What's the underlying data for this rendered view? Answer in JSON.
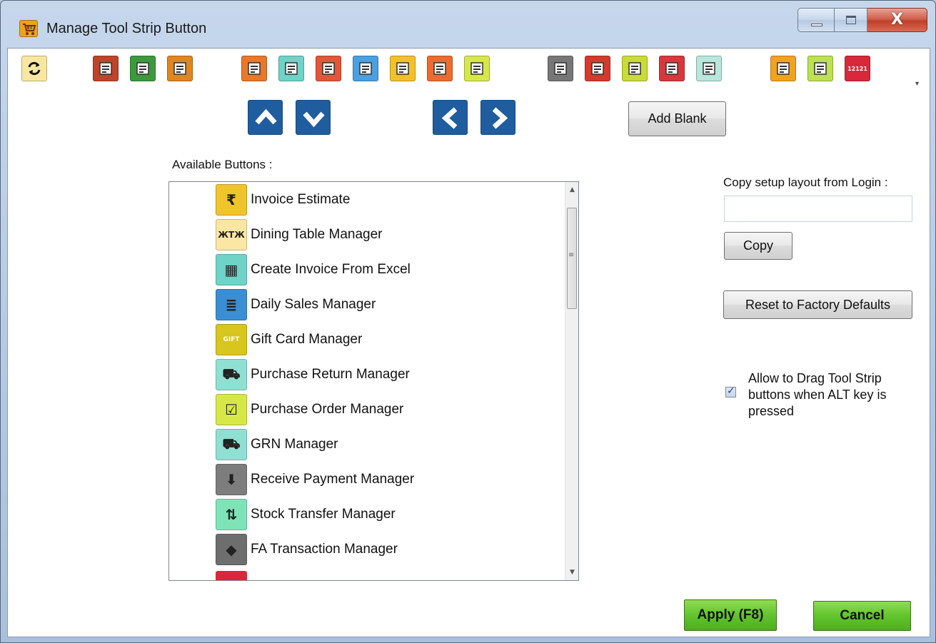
{
  "window": {
    "title": "Manage Tool Strip Button",
    "close_glyph": "X"
  },
  "toolstrip": {
    "buttons": [
      {
        "name": "refresh-icon",
        "color": "#f7e7a1"
      },
      {
        "name": "report-icon-1",
        "color": "#c0432a"
      },
      {
        "name": "report-icon-2",
        "color": "#3c9a3c"
      },
      {
        "name": "report-icon-3",
        "color": "#e0861d"
      },
      {
        "name": "invoice-edit-icon",
        "color": "#e8782a"
      },
      {
        "name": "cart-icon",
        "color": "#6fd3c7"
      },
      {
        "name": "receive-payment-icon",
        "color": "#e4553a"
      },
      {
        "name": "stock-transfer-icon",
        "color": "#4aa0e0"
      },
      {
        "name": "notes-icon",
        "color": "#f2c12a"
      },
      {
        "name": "home-icon",
        "color": "#ef6b2c"
      },
      {
        "name": "checklist-icon",
        "color": "#d6e847"
      },
      {
        "name": "coin-icon",
        "color": "#777777"
      },
      {
        "name": "cancel-icon",
        "color": "#d9382c"
      },
      {
        "name": "calculator-icon",
        "color": "#c9dc34"
      },
      {
        "name": "tax-icon",
        "color": "#d8383c"
      },
      {
        "name": "calculator-2-icon",
        "color": "#b8e7dc"
      },
      {
        "name": "apps-grid-icon",
        "color": "#f2a31c"
      },
      {
        "name": "user-icon",
        "color": "#bde14f"
      },
      {
        "name": "number-counter-icon",
        "color": "#d9283a"
      }
    ],
    "counter_text": "12121",
    "overflow_glyph": "▾"
  },
  "nav": {
    "add_blank_label": "Add Blank"
  },
  "available": {
    "label": "Available  Buttons :",
    "items": [
      {
        "label": "Invoice Estimate",
        "icon": "invoice-estimate-icon",
        "color": "#f0c42c",
        "sym": "₹"
      },
      {
        "label": "Dining Table Manager",
        "icon": "dining-table-icon",
        "color": "#fbe6a3",
        "sym": "ЖTЖ"
      },
      {
        "label": "Create Invoice From Excel",
        "icon": "excel-invoice-icon",
        "color": "#6fd3c7",
        "sym": "▦"
      },
      {
        "label": "Daily Sales Manager",
        "icon": "daily-sales-icon",
        "color": "#3a8ed4",
        "sym": "≣"
      },
      {
        "label": "Gift Card Manager",
        "icon": "gift-card-icon",
        "color": "#d6c61e",
        "sym": "GIFT"
      },
      {
        "label": "Purchase Return Manager",
        "icon": "purchase-return-icon",
        "color": "#8fe0d3",
        "sym": "⛟"
      },
      {
        "label": "Purchase Order Manager",
        "icon": "purchase-order-icon",
        "color": "#d6e847",
        "sym": "☑"
      },
      {
        "label": "GRN Manager",
        "icon": "grn-truck-icon",
        "color": "#8fe0d3",
        "sym": "⛟"
      },
      {
        "label": "Receive Payment Manager",
        "icon": "receive-payment-icon",
        "color": "#7d7d7d",
        "sym": "⬇"
      },
      {
        "label": "Stock Transfer Manager",
        "icon": "stock-transfer-icon",
        "color": "#7fe3b8",
        "sym": "⇅"
      },
      {
        "label": "FA Transaction Manager",
        "icon": "fa-transaction-icon",
        "color": "#6e6e6e",
        "sym": "◆"
      }
    ],
    "scroll_grip": "≡"
  },
  "copy_setup": {
    "label": "Copy setup layout from Login :",
    "value": "",
    "copy_label": "Copy",
    "reset_label": "Reset to Factory Defaults"
  },
  "drag_option": {
    "checked": true,
    "check_glyph": "✓",
    "label": "Allow to Drag Tool Strip buttons when ALT key is pressed"
  },
  "footer": {
    "apply_label": "Apply (F8)",
    "cancel_label": "Cancel"
  }
}
